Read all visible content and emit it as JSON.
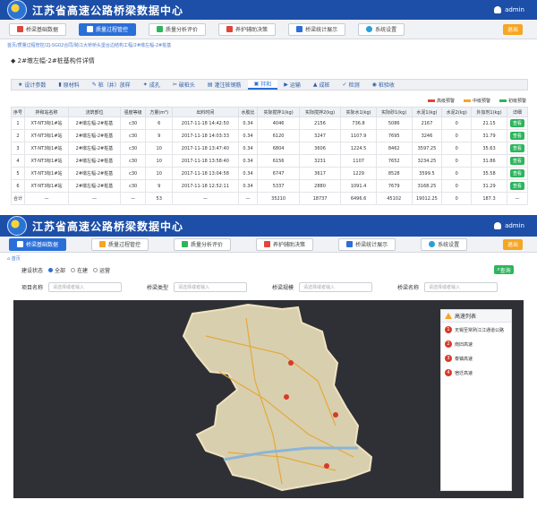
{
  "app": {
    "title": "江苏省高速公路桥梁数据中心",
    "user": "admin",
    "exit_label": "退出"
  },
  "nav": [
    {
      "label": "桥梁基础数据",
      "color": "#e0463a"
    },
    {
      "label": "质量过程管控",
      "color": "#2a6fd8"
    },
    {
      "label": "质量分析评价",
      "color": "#2db55d"
    },
    {
      "label": "养护辅助决策",
      "color": "#e0463a"
    },
    {
      "label": "桥梁统计展示",
      "color": "#2a6fd8"
    },
    {
      "label": "系统设置",
      "color": "#2a9fd8"
    }
  ],
  "top": {
    "breadcrumb": "首页/质量过程管控/ZJ-SG02合同/跨江大桥桥头堡台边结构工程/2#墩左幅-2#桩基",
    "section_title": "2#墩左幅-2#桩基构件详情",
    "tabs": [
      "设计参数",
      "原材料",
      "桩（井）放样",
      "成孔",
      "破桩头",
      "灌注桩钢筋",
      "拌和",
      "运输",
      "成桩",
      "检测",
      "桩验收"
    ],
    "active_tab": 6,
    "legend": [
      {
        "label": "高级预警",
        "color": "#e0463a"
      },
      {
        "label": "中级预警",
        "color": "#f5a623"
      },
      {
        "label": "初级预警",
        "color": "#2db55d"
      }
    ],
    "table": {
      "headers": [
        "序号",
        "拌和站名称",
        "浇筑部位",
        "强度等级",
        "方量(m³)",
        "出料时间",
        "水胶比",
        "实际搅拌1(kg)",
        "实际搅拌2(kg)",
        "实际水1(kg)",
        "实际砂1(kg)",
        "水泥1(kg)",
        "水泥2(kg)",
        "外加剂1(kg)",
        "详细"
      ],
      "rows": [
        [
          "1",
          "XT-NT3标1#站",
          "2#墩左幅-2#桩基",
          "c30",
          "6",
          "2017-11-18 14:42:50",
          "0.34",
          "4046",
          "2156",
          "736.8",
          "5086",
          "2167",
          "0",
          "21.15",
          "查看"
        ],
        [
          "2",
          "XT-NT3标1#站",
          "2#墩左幅-2#桩基",
          "c30",
          "9",
          "2017-11-18 14:03:33",
          "0.34",
          "6120",
          "3247",
          "1107.9",
          "7695",
          "3246",
          "0",
          "31.79",
          "查看"
        ],
        [
          "3",
          "XT-NT3标1#站",
          "2#墩左幅-2#桩基",
          "c30",
          "10",
          "2017-11-18 13:47:40",
          "0.34",
          "6804",
          "3606",
          "1224.5",
          "8462",
          "3597.25",
          "0",
          "35.63",
          "查看"
        ],
        [
          "4",
          "XT-NT3标1#站",
          "2#墩左幅-2#桩基",
          "c30",
          "10",
          "2017-11-18 13:58:40",
          "0.34",
          "6156",
          "3231",
          "1107",
          "7652",
          "3234.25",
          "0",
          "31.86",
          "查看"
        ],
        [
          "5",
          "XT-NT3标1#站",
          "2#墩左幅-2#桩基",
          "c30",
          "10",
          "2017-11-18 13:04:58",
          "0.34",
          "6747",
          "3617",
          "1229",
          "8528",
          "3599.5",
          "0",
          "35.58",
          "查看"
        ],
        [
          "6",
          "XT-NT3标1#站",
          "2#墩左幅-2#桩基",
          "c30",
          "9",
          "2017-11-18 12:52:11",
          "0.34",
          "5337",
          "2880",
          "1091.4",
          "7679",
          "3168.25",
          "0",
          "31.29",
          "查看"
        ],
        [
          "合计",
          "—",
          "—",
          "—",
          "53",
          "—",
          "—",
          "35210",
          "18737",
          "6496.6",
          "45102",
          "19012.25",
          "0",
          "187.3",
          "—"
        ]
      ]
    }
  },
  "bottom": {
    "crumb": "首页",
    "status_label": "建设状态",
    "radios": [
      "全部",
      "在建",
      "运营"
    ],
    "query_label": "查询",
    "filters": [
      {
        "label": "项目名称",
        "placeholder": "请选择或者输入"
      },
      {
        "label": "桥梁类型",
        "placeholder": "请选择或者输入"
      },
      {
        "label": "桥梁规模",
        "placeholder": "请选择或者输入"
      },
      {
        "label": "桥梁名称",
        "placeholder": "请选择或者输入"
      }
    ],
    "panel": {
      "title": "高速列表",
      "items": [
        "无锡至常熟江江通道公路",
        "南旧高速",
        "泰镇高速",
        "宿迁高速"
      ]
    }
  }
}
